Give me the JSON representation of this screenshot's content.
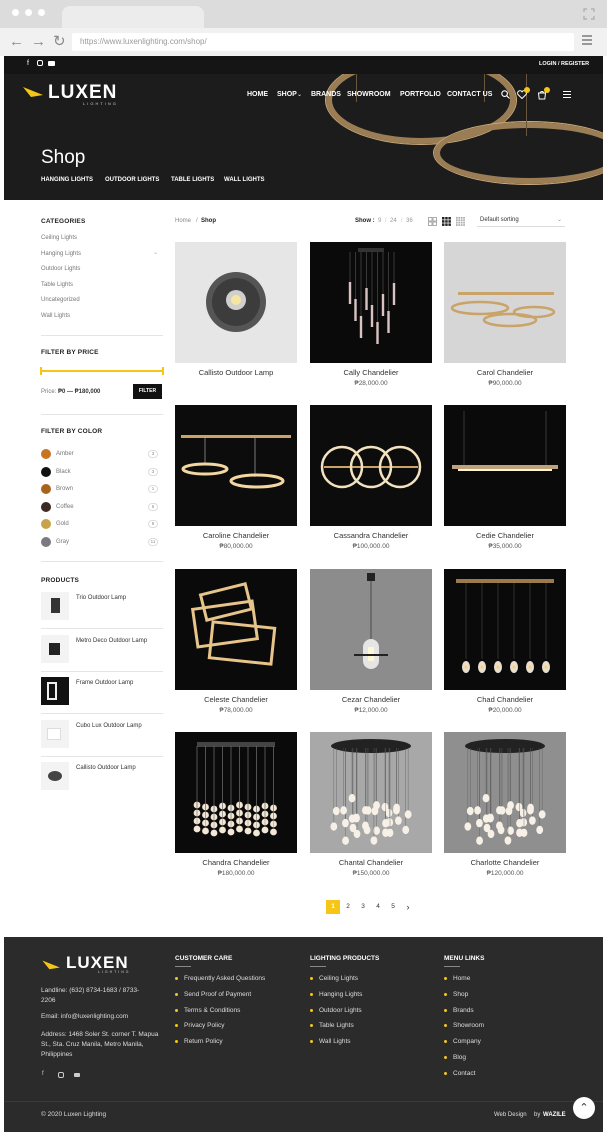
{
  "browser": {
    "url": "https://www.luxenlighting.com/shop/"
  },
  "header": {
    "login_register": "LOGIN / REGISTER",
    "logo_text": "LUXEN",
    "logo_sub": "LIGHTING",
    "nav": [
      "HOME",
      "SHOP",
      "BRANDS",
      "SHOWROOM",
      "PORTFOLIO",
      "CONTACT US"
    ],
    "page_title": "Shop",
    "category_tabs": [
      "HANGING LIGHTS",
      "OUTDOOR LIGHTS",
      "TABLE LIGHTS",
      "WALL LIGHTS"
    ],
    "wishlist_count": "",
    "cart_count": ""
  },
  "sidebar": {
    "categories_title": "CATEGORIES",
    "categories": [
      "Ceiling Lights",
      "Hanging Lights",
      "Outdoor Lights",
      "Table Lights",
      "Uncategorized",
      "Wall Lights"
    ],
    "price_title": "FILTER BY PRICE",
    "price_label": "Price:",
    "price_range": "₱0 — ₱180,000",
    "filter_button": "FILTER",
    "color_title": "FILTER BY COLOR",
    "colors": [
      {
        "name": "Amber",
        "count": "3",
        "hex": "#c77420"
      },
      {
        "name": "Black",
        "count": "3",
        "hex": "#111111"
      },
      {
        "name": "Brown",
        "count": "1",
        "hex": "#a8641c"
      },
      {
        "name": "Coffee",
        "count": "5",
        "hex": "#3a2a22"
      },
      {
        "name": "Gold",
        "count": "6",
        "hex": "#c8a24a"
      },
      {
        "name": "Gray",
        "count": "11",
        "hex": "#7a7a80"
      }
    ],
    "products_title": "PRODUCTS",
    "products": [
      "Trio Outdoor Lamp",
      "Metro Deco Outdoor Lamp",
      "Frame Outdoor Lamp",
      "Cubo Lux Outdoor Lamp",
      "Callisto Outdoor Lamp"
    ]
  },
  "toolbar": {
    "breadcrumb_home": "Home",
    "breadcrumb_current": "Shop",
    "show_label": "Show :",
    "show_options": [
      "9",
      "24",
      "36"
    ],
    "sorting": "Default sorting"
  },
  "products": [
    {
      "name": "Callisto Outdoor Lamp",
      "price": "",
      "bg": "#e6e6e6"
    },
    {
      "name": "Cally Chandelier",
      "price": "₱28,000.00",
      "bg": "#0a0a0a"
    },
    {
      "name": "Carol Chandelier",
      "price": "₱90,000.00",
      "bg": "#d6d6d6"
    },
    {
      "name": "Caroline Chandelier",
      "price": "₱80,000.00",
      "bg": "#0c0c0c"
    },
    {
      "name": "Cassandra Chandelier",
      "price": "₱100,000.00",
      "bg": "#0c0c0c"
    },
    {
      "name": "Cedie Chandelier",
      "price": "₱35,000.00",
      "bg": "#0a0a0a"
    },
    {
      "name": "Celeste Chandelier",
      "price": "₱78,000.00",
      "bg": "#0a0a0a"
    },
    {
      "name": "Cezar Chandelier",
      "price": "₱12,000.00",
      "bg": "#8c8c8c"
    },
    {
      "name": "Chad Chandelier",
      "price": "₱20,000.00",
      "bg": "#0a0a0a"
    },
    {
      "name": "Chandra Chandelier",
      "price": "₱180,000.00",
      "bg": "#0a0a0a"
    },
    {
      "name": "Chantal Chandelier",
      "price": "₱150,000.00",
      "bg": "#a8a8a8"
    },
    {
      "name": "Charlotte Chandelier",
      "price": "₱120,000.00",
      "bg": "#8f8f8f"
    }
  ],
  "pagination": {
    "pages": [
      "1",
      "2",
      "3",
      "4",
      "5"
    ],
    "next": "›"
  },
  "footer": {
    "logo_text": "LUXEN",
    "logo_sub": "LIGHTING",
    "landline": "Landline: (632) 8734-1683 / 8733-2206",
    "email": "Email: info@luxenlighting.com",
    "address": "Address: 1468 Soler St. corner T. Mapua St., Sta. Cruz Manila, Metro Manila, Philippines",
    "customer_care_title": "CUSTOMER CARE",
    "customer_care": [
      "Frequently Asked Questions",
      "Send Proof of Payment",
      "Terms & Conditions",
      "Privacy Policy",
      "Return Policy"
    ],
    "lighting_title": "LIGHTING PRODUCTS",
    "lighting": [
      "Ceiling Lights",
      "Hanging Lights",
      "Outdoor Lights",
      "Table Lights",
      "Wall Lights"
    ],
    "menu_title": "MENU LINKS",
    "menu": [
      "Home",
      "Shop",
      "Brands",
      "Showroom",
      "Company",
      "Blog",
      "Contact"
    ],
    "copyright": "© 2020 Luxen Lighting",
    "credit_prefix": "Web Design",
    "credit_by": "by",
    "credit_name": "WAZILE"
  },
  "colors": {
    "accent": "#f5c518",
    "dark": "#1c1c1c",
    "footer": "#2b2b2b"
  }
}
